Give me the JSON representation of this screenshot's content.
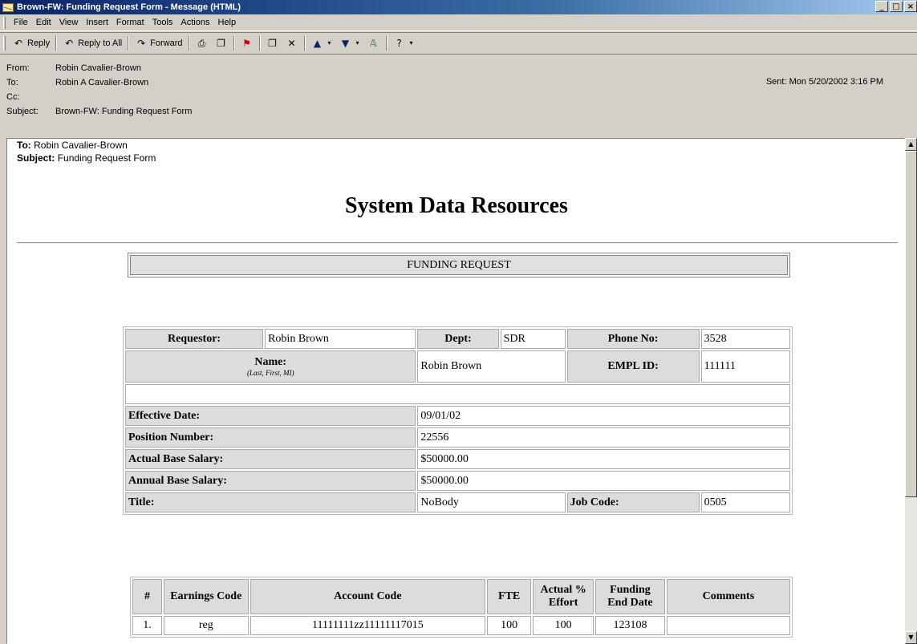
{
  "window": {
    "title": "Brown-FW: Funding Request Form - Message (HTML)",
    "min": "_",
    "max": "□",
    "close": "×"
  },
  "menu": [
    "File",
    "Edit",
    "View",
    "Insert",
    "Format",
    "Tools",
    "Actions",
    "Help"
  ],
  "toolbar": {
    "reply": "Reply",
    "reply_all": "Reply to All",
    "forward": "Forward"
  },
  "header": {
    "from_label": "From:",
    "from": "Robin Cavalier-Brown",
    "to_label": "To:",
    "to": "Robin A Cavalier-Brown",
    "cc_label": "Cc:",
    "cc": "",
    "subject_label": "Subject:",
    "subject": "Brown-FW: Funding Request Form",
    "sent_label": "Sent:",
    "sent": "Mon 5/20/2002 3:16 PM"
  },
  "body": {
    "fwd_to_label": "To:",
    "fwd_to": "Robin Cavalier-Brown",
    "fwd_subject_label": "Subject:",
    "fwd_subject": "Funding Request Form",
    "heading": "System Data Resources",
    "form_title": "FUNDING REQUEST"
  },
  "form": {
    "requestor_label": "Requestor:",
    "requestor": "Robin Brown",
    "dept_label": "Dept:",
    "dept": "SDR",
    "phone_label": "Phone No:",
    "phone": "3528",
    "name_label": "Name:",
    "name_hint": "(Last, First, MI)",
    "name": "Robin Brown",
    "empl_label": "EMPL ID:",
    "empl": "111111",
    "effective_label": "Effective Date:",
    "effective": "09/01/02",
    "position_label": "Position Number:",
    "position": "22556",
    "actual_label": "Actual Base Salary:",
    "actual": "$50000.00",
    "annual_label": "Annual Base Salary:",
    "annual": "$50000.00",
    "title_label": "Title:",
    "title": "NoBody",
    "jobcode_label": "Job Code:",
    "jobcode": "0505"
  },
  "funding": {
    "headers": [
      "#",
      "Earnings Code",
      "Account Code",
      "FTE",
      "Actual % Effort",
      "Funding End Date",
      "Comments"
    ],
    "rows": [
      [
        "1.",
        "reg",
        "11111111zz11111117015",
        "100",
        "100",
        "123108",
        ""
      ]
    ]
  }
}
